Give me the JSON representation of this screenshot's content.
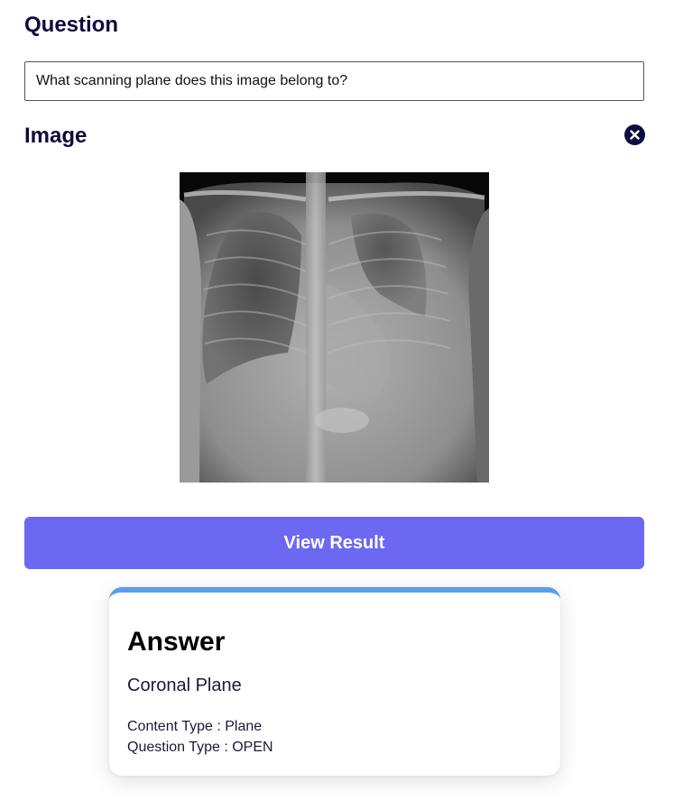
{
  "question": {
    "title": "Question",
    "input_value": "What scanning plane does this image belong to?"
  },
  "image": {
    "title": "Image",
    "close_icon": "close-circle-icon",
    "content": "chest x-ray"
  },
  "actions": {
    "view_result_label": "View Result",
    "accent_color": "#6c68f2"
  },
  "answer": {
    "heading": "Answer",
    "value": "Coronal Plane",
    "content_type": "Content Type : Plane",
    "question_type": "Question Type : OPEN",
    "border_color": "#58a0e8"
  }
}
